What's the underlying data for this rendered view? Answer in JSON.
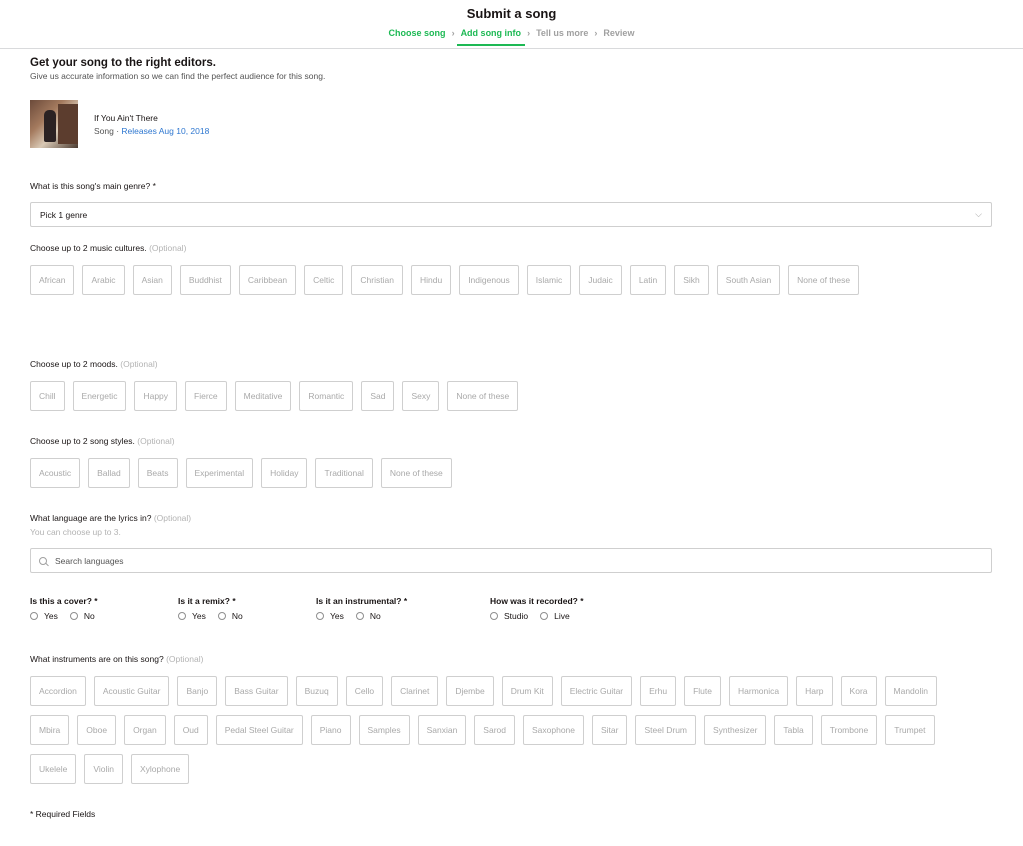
{
  "header": {
    "title": "Submit a song",
    "steps": [
      "Choose song",
      "Add song info",
      "Tell us more",
      "Review"
    ]
  },
  "intro": {
    "title": "Get your song to the right editors.",
    "subtitle": "Give us accurate information so we can find the perfect audience for this song."
  },
  "song": {
    "title": "If You Ain't There",
    "type": "Song",
    "separator": " · ",
    "release": "Releases Aug 10, 2018"
  },
  "genre": {
    "label": "What is this song's main genre? *",
    "value": "Pick 1 genre"
  },
  "cultures": {
    "label": "Choose up to 2 music cultures.",
    "optional": "(Optional)",
    "items": [
      "African",
      "Arabic",
      "Asian",
      "Buddhist",
      "Caribbean",
      "Celtic",
      "Christian",
      "Hindu",
      "Indigenous",
      "Islamic",
      "Judaic",
      "Latin",
      "Sikh",
      "South Asian",
      "None of these"
    ]
  },
  "moods": {
    "label": "Choose up to 2 moods.",
    "optional": "(Optional)",
    "items": [
      "Chill",
      "Energetic",
      "Happy",
      "Fierce",
      "Meditative",
      "Romantic",
      "Sad",
      "Sexy",
      "None of these"
    ]
  },
  "styles": {
    "label": "Choose up to 2 song styles.",
    "optional": "(Optional)",
    "items": [
      "Acoustic",
      "Ballad",
      "Beats",
      "Experimental",
      "Holiday",
      "Traditional",
      "None of these"
    ]
  },
  "language": {
    "label": "What language are the lyrics in?",
    "optional": "(Optional)",
    "hint": "You can choose up to 3.",
    "placeholder": "Search languages"
  },
  "questions": [
    {
      "label": "Is this a cover? *",
      "options": [
        "Yes",
        "No"
      ]
    },
    {
      "label": "Is it a remix? *",
      "options": [
        "Yes",
        "No"
      ]
    },
    {
      "label": "Is it an instrumental? *",
      "options": [
        "Yes",
        "No"
      ]
    },
    {
      "label": "How was it recorded? *",
      "options": [
        "Studio",
        "Live"
      ]
    }
  ],
  "instruments": {
    "label": "What instruments are on this song?",
    "optional": "(Optional)",
    "items": [
      "Accordion",
      "Acoustic Guitar",
      "Banjo",
      "Bass Guitar",
      "Buzuq",
      "Cello",
      "Clarinet",
      "Djembe",
      "Drum Kit",
      "Electric Guitar",
      "Erhu",
      "Flute",
      "Harmonica",
      "Harp",
      "Kora",
      "Mandolin",
      "Mbira",
      "Oboe",
      "Organ",
      "Oud",
      "Pedal Steel Guitar",
      "Piano",
      "Samples",
      "Sanxian",
      "Sarod",
      "Saxophone",
      "Sitar",
      "Steel Drum",
      "Synthesizer",
      "Tabla",
      "Trombone",
      "Trumpet",
      "Ukelele",
      "Violin",
      "Xylophone"
    ]
  },
  "footer": {
    "required_note": "* Required Fields"
  },
  "colors": {
    "accent": "#1db954",
    "link": "#2e77d0",
    "muted": "#b3b3b3",
    "border": "#cfcfcf"
  }
}
